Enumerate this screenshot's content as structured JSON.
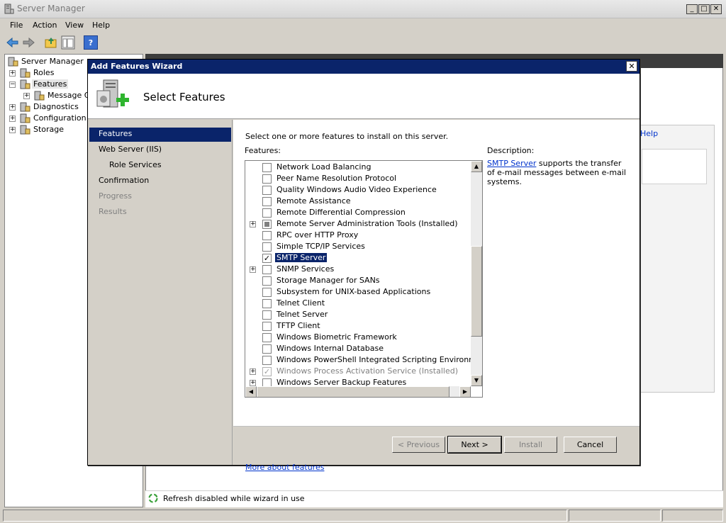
{
  "main_window": {
    "title": "Server Manager",
    "controls": [
      "_",
      "□",
      "✕"
    ]
  },
  "menu": [
    "File",
    "Action",
    "View",
    "Help"
  ],
  "toolbar": {
    "buttons": [
      "back-icon",
      "forward-icon",
      "up-folder-icon",
      "show-hide-tree-icon",
      "help-icon"
    ],
    "help_glyph": "?"
  },
  "tree": {
    "items": [
      {
        "label": "Server Manager",
        "icon": "server-icon",
        "indent": 0,
        "expander": ""
      },
      {
        "label": "Roles",
        "icon": "roles-icon",
        "indent": 1,
        "expander": "+"
      },
      {
        "label": "Features",
        "icon": "features-icon",
        "indent": 1,
        "expander": "−",
        "selected": true
      },
      {
        "label": "Message Qu",
        "icon": "message-queue-icon",
        "indent": 2,
        "expander": "+"
      },
      {
        "label": "Diagnostics",
        "icon": "diagnostics-icon",
        "indent": 1,
        "expander": "+"
      },
      {
        "label": "Configuration",
        "icon": "configuration-icon",
        "indent": 1,
        "expander": "+"
      },
      {
        "label": "Storage",
        "icon": "storage-icon",
        "indent": 1,
        "expander": "+"
      }
    ]
  },
  "right_pane": {
    "help_link": "Help",
    "status_text": "Refresh disabled while wizard in use"
  },
  "wizard": {
    "title": "Add Features Wizard",
    "close": "✕",
    "heading": "Select Features",
    "nav": [
      {
        "label": "Features",
        "state": "active",
        "sub": false
      },
      {
        "label": "Web Server (IIS)",
        "state": "normal",
        "sub": false
      },
      {
        "label": "Role Services",
        "state": "normal",
        "sub": true
      },
      {
        "label": "Confirmation",
        "state": "normal",
        "sub": false
      },
      {
        "label": "Progress",
        "state": "disabled",
        "sub": false
      },
      {
        "label": "Results",
        "state": "disabled",
        "sub": false
      }
    ],
    "instructions": "Select one or more features to install on this server.",
    "features_label": "Features:",
    "description_label": "Description:",
    "description_link": "SMTP Server",
    "description_text": " supports the transfer of e-mail messages between e-mail systems.",
    "features": [
      {
        "label": "Network Load Balancing",
        "check": "unchecked",
        "expander": false
      },
      {
        "label": "Peer Name Resolution Protocol",
        "check": "unchecked",
        "expander": false
      },
      {
        "label": "Quality Windows Audio Video Experience",
        "check": "unchecked",
        "expander": false
      },
      {
        "label": "Remote Assistance",
        "check": "unchecked",
        "expander": false
      },
      {
        "label": "Remote Differential Compression",
        "check": "unchecked",
        "expander": false
      },
      {
        "label": "Remote Server Administration Tools  (Installed)",
        "check": "mixed",
        "expander": true
      },
      {
        "label": "RPC over HTTP Proxy",
        "check": "unchecked",
        "expander": false
      },
      {
        "label": "Simple TCP/IP Services",
        "check": "unchecked",
        "expander": false
      },
      {
        "label": "SMTP Server",
        "check": "checked",
        "expander": false,
        "selected": true
      },
      {
        "label": "SNMP Services",
        "check": "unchecked",
        "expander": true
      },
      {
        "label": "Storage Manager for SANs",
        "check": "unchecked",
        "expander": false
      },
      {
        "label": "Subsystem for UNIX-based Applications",
        "check": "unchecked",
        "expander": false
      },
      {
        "label": "Telnet Client",
        "check": "unchecked",
        "expander": false
      },
      {
        "label": "Telnet Server",
        "check": "unchecked",
        "expander": false
      },
      {
        "label": "TFTP Client",
        "check": "unchecked",
        "expander": false
      },
      {
        "label": "Windows Biometric Framework",
        "check": "unchecked",
        "expander": false
      },
      {
        "label": "Windows Internal Database",
        "check": "unchecked",
        "expander": false
      },
      {
        "label": "Windows PowerShell Integrated Scripting Environment (IS",
        "check": "unchecked",
        "expander": false
      },
      {
        "label": "Windows Process Activation Service  (Installed)",
        "check": "checked-disabled",
        "expander": true,
        "greyed": true
      },
      {
        "label": "Windows Server Backup Features",
        "check": "unchecked",
        "expander": true
      }
    ],
    "more_link": "More about features",
    "buttons": {
      "previous": "< Previous",
      "next": "Next >",
      "install": "Install",
      "cancel": "Cancel"
    }
  },
  "colors": {
    "title_active": "#0a246a",
    "link": "#0033cc",
    "face": "#d4d0c8"
  }
}
